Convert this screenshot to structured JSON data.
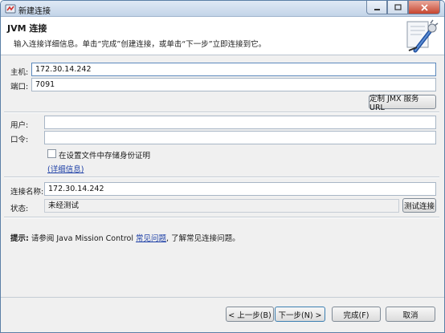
{
  "window": {
    "title": "新建连接"
  },
  "banner": {
    "title": "JVM 连接",
    "description": "输入连接详细信息。单击“完成”创建连接，或单击“下一步”立即连接到它。"
  },
  "form": {
    "host_label": "主机:",
    "host_value": "172.30.14.242",
    "port_label": "端口:",
    "port_value": "7091",
    "custom_jmx_button": "定制 JMX 服务 URL",
    "user_label": "用户:",
    "user_value": "",
    "password_label": "口令:",
    "password_value": "",
    "store_credentials_label": "在设置文件中存储身份证明",
    "store_credentials_checked": false,
    "details_link": "(详细信息)",
    "connection_name_label": "连接名称:",
    "connection_name_value": "172.30.14.242",
    "status_label": "状态:",
    "status_value": "未经测试",
    "test_connection_button": "测试连接"
  },
  "hint": {
    "prefix": "提示:",
    "text_before": " 请参阅 Java Mission Control ",
    "link": "常见问题",
    "text_after": ", 了解常见连接问题。"
  },
  "footer": {
    "back_button": "< 上一步(B)",
    "next_button": "下一步(N) >",
    "finish_button": "完成(F)",
    "cancel_button": "取消"
  },
  "icons": {
    "app": "app-icon",
    "wizard": "plug-wizard-icon",
    "minimize": "minimize-icon",
    "maximize": "maximize-icon",
    "close": "close-icon"
  }
}
